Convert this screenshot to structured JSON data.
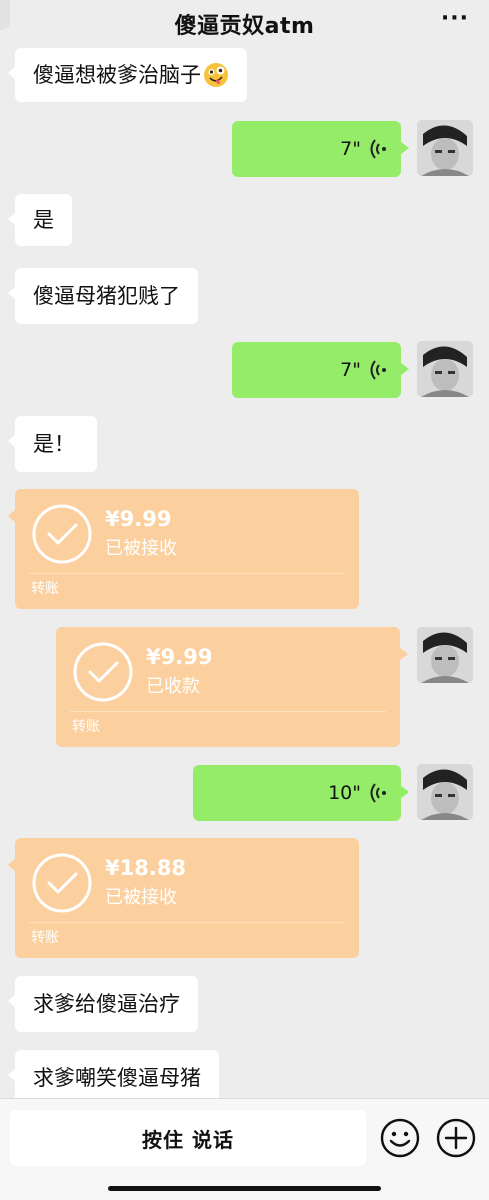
{
  "header": {
    "title": "傻逼贡奴atm",
    "more_icon": "more-dots-icon"
  },
  "messages": [
    {
      "type": "text",
      "side": "left",
      "text": "傻逼想被爹治脑子",
      "emoji": "zany-face"
    },
    {
      "type": "voice",
      "side": "right",
      "duration": "7\""
    },
    {
      "type": "text",
      "side": "left",
      "text": "是"
    },
    {
      "type": "text",
      "side": "left",
      "text": "傻逼母猪犯贱了"
    },
    {
      "type": "voice",
      "side": "right",
      "duration": "7\""
    },
    {
      "type": "text",
      "side": "left",
      "text": "是！"
    },
    {
      "type": "transfer",
      "side": "left",
      "amount": "¥9.99",
      "status": "已被接收",
      "label": "转账"
    },
    {
      "type": "transfer",
      "side": "right",
      "amount": "¥9.99",
      "status": "已收款",
      "label": "转账"
    },
    {
      "type": "voice",
      "side": "right",
      "duration": "10\""
    },
    {
      "type": "transfer",
      "side": "left",
      "amount": "¥18.88",
      "status": "已被接收",
      "label": "转账"
    },
    {
      "type": "text",
      "side": "left",
      "text": "求爹给傻逼治疗"
    },
    {
      "type": "text",
      "side": "left",
      "text": "求爹嘲笑傻逼母猪"
    }
  ],
  "input_bar": {
    "hold_to_talk": "按住 说话",
    "emoji_icon": "smiley-icon",
    "plus_icon": "plus-circle-icon"
  },
  "colors": {
    "background": "#ededed",
    "voice_bubble": "#95ec69",
    "transfer_bubble": "#fcd09e",
    "text_bubble": "#ffffff"
  }
}
